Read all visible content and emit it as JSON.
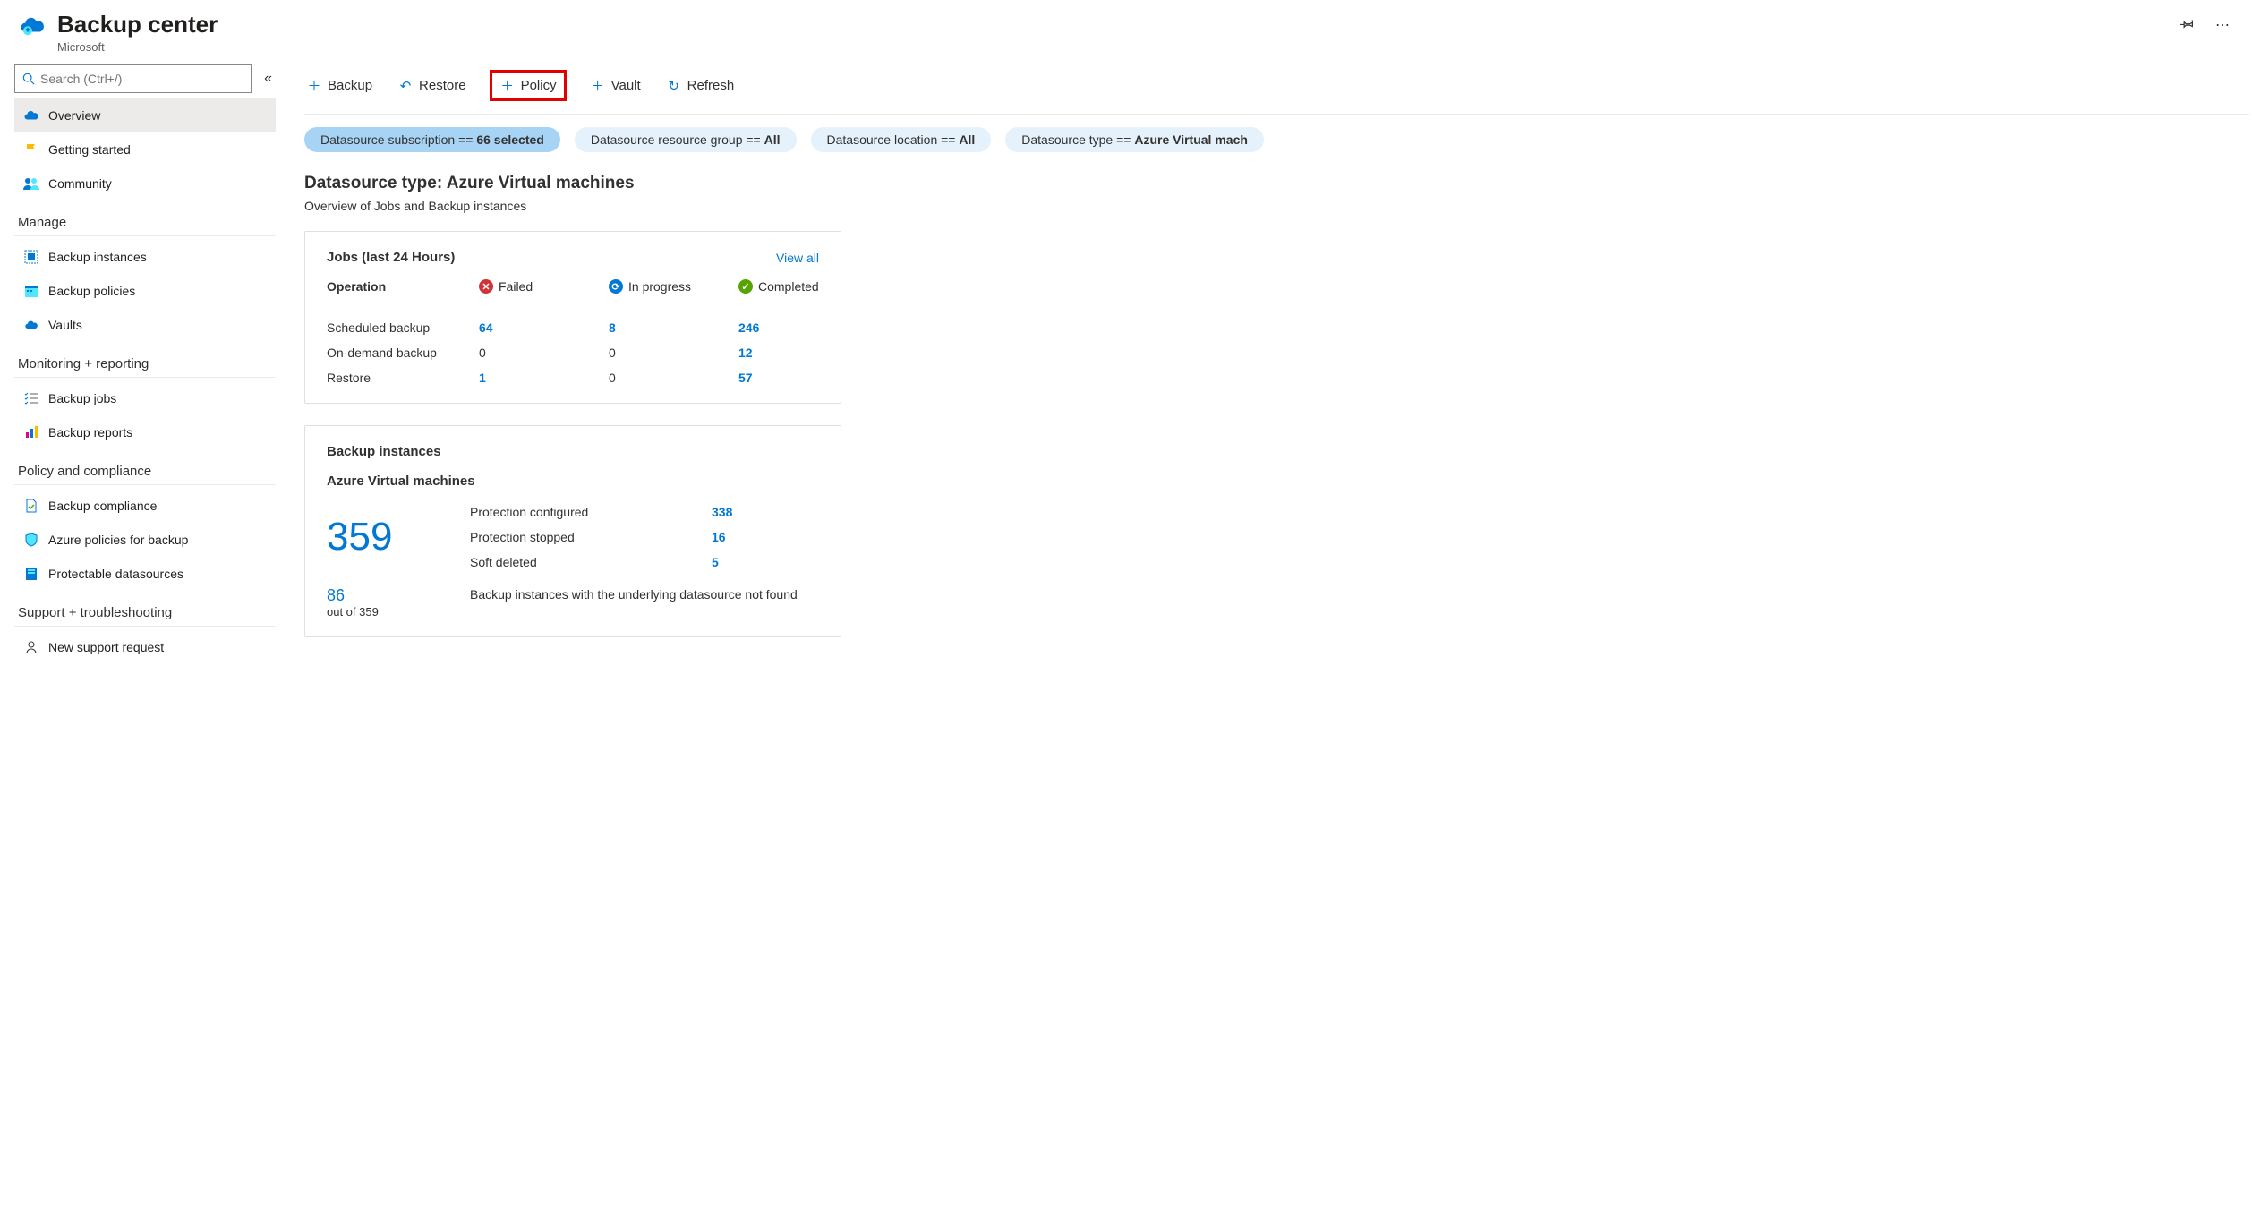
{
  "header": {
    "title": "Backup center",
    "subtitle": "Microsoft"
  },
  "sidebar": {
    "search_placeholder": "Search (Ctrl+/)",
    "top_items": [
      {
        "label": "Overview",
        "icon": "#0078d4"
      },
      {
        "label": "Getting started",
        "icon": "#ffb900"
      },
      {
        "label": "Community",
        "icon": "#0078d4"
      }
    ],
    "sections": [
      {
        "title": "Manage",
        "items": [
          {
            "label": "Backup instances"
          },
          {
            "label": "Backup policies"
          },
          {
            "label": "Vaults"
          }
        ]
      },
      {
        "title": "Monitoring + reporting",
        "items": [
          {
            "label": "Backup jobs"
          },
          {
            "label": "Backup reports"
          }
        ]
      },
      {
        "title": "Policy and compliance",
        "items": [
          {
            "label": "Backup compliance"
          },
          {
            "label": "Azure policies for backup"
          },
          {
            "label": "Protectable datasources"
          }
        ]
      },
      {
        "title": "Support + troubleshooting",
        "items": [
          {
            "label": "New support request"
          }
        ]
      }
    ]
  },
  "toolbar": {
    "backup": "Backup",
    "restore": "Restore",
    "policy": "Policy",
    "vault": "Vault",
    "refresh": "Refresh"
  },
  "filters": {
    "sub_label": "Datasource subscription == ",
    "sub_value": "66 selected",
    "rg_label": "Datasource resource group == ",
    "rg_value": "All",
    "loc_label": "Datasource location == ",
    "loc_value": "All",
    "type_label": "Datasource type == ",
    "type_value": "Azure Virtual mach"
  },
  "main": {
    "title": "Datasource type: Azure Virtual machines",
    "subtitle": "Overview of Jobs and Backup instances"
  },
  "jobs_card": {
    "title": "Jobs (last 24 Hours)",
    "view_all": "View all",
    "op_header": "Operation",
    "failed_header": "Failed",
    "prog_header": "In progress",
    "comp_header": "Completed",
    "rows": [
      {
        "op": "Scheduled backup",
        "failed": "64",
        "prog": "8",
        "comp": "246"
      },
      {
        "op": "On-demand backup",
        "failed": "0",
        "prog": "0",
        "comp": "12"
      },
      {
        "op": "Restore",
        "failed": "1",
        "prog": "0",
        "comp": "57"
      }
    ]
  },
  "bi_card": {
    "title": "Backup instances",
    "subtitle": "Azure Virtual machines",
    "total": "359",
    "rows": [
      {
        "label": "Protection configured",
        "value": "338"
      },
      {
        "label": "Protection stopped",
        "value": "16"
      },
      {
        "label": "Soft deleted",
        "value": "5"
      }
    ],
    "notfound_count": "86",
    "notfound_out": "out of 359",
    "notfound_text": "Backup instances with the underlying datasource not found"
  }
}
